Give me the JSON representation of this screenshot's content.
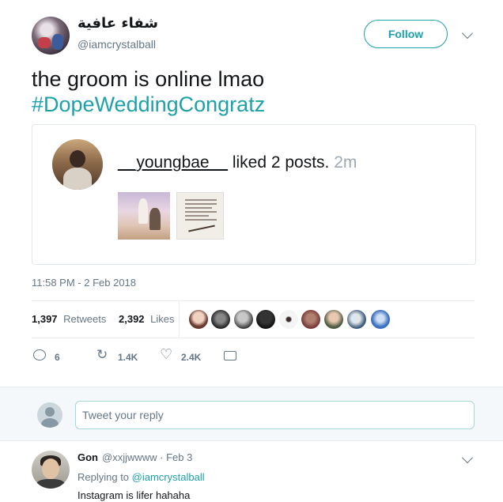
{
  "tweet": {
    "display_name": "شفاء عافية",
    "handle": "@iamcrystalball",
    "follow_label": "Follow",
    "text_line1": "the groom is online lmao",
    "hashtag": "#DopeWeddingCongratz",
    "timestamp": "11:58 PM - 2 Feb 2018"
  },
  "embedded_image": {
    "username": "__youngbae__",
    "action_text": " liked 2 posts. ",
    "time_ago": "2m"
  },
  "stats": {
    "retweets_count": "1,397",
    "retweets_label": "Retweets",
    "likes_count": "2,392",
    "likes_label": "Likes"
  },
  "actions": {
    "reply_count": "6",
    "retweet_count": "1.4K",
    "like_count": "2.4K"
  },
  "reply_box": {
    "placeholder": "Tweet your reply"
  },
  "comment": {
    "name": "Gon",
    "handle_date": "@xxjjwwww · Feb 3",
    "replying_prefix": "Replying to ",
    "replying_to": "@iamcrystalball",
    "text": "Instagram is lifer hahaha"
  },
  "colors": {
    "accent": "#1da1a8",
    "secondary_text": "#657786",
    "border": "#e6ecf0"
  },
  "icons": [
    "caret-down-icon",
    "reply-icon",
    "retweet-icon",
    "heart-icon",
    "envelope-icon"
  ]
}
